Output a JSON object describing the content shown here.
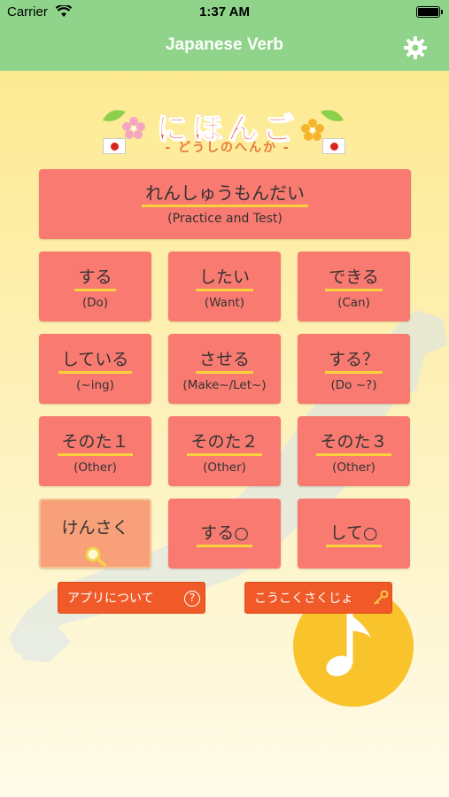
{
  "status": {
    "carrier": "Carrier",
    "time": "1:37 AM"
  },
  "nav": {
    "title": "Japanese Verb",
    "settings_icon": "gear-icon"
  },
  "logo": {
    "title": "にほんご",
    "subtitle": "- どうしのへんか -"
  },
  "practice": {
    "jp": "れんしゅうもんだい",
    "en": "(Practice and Test)"
  },
  "grid": [
    {
      "jp": "する",
      "en": "(Do)"
    },
    {
      "jp": "したい",
      "en": "(Want)"
    },
    {
      "jp": "できる",
      "en": "(Can)"
    },
    {
      "jp": "している",
      "en": "(~ing)"
    },
    {
      "jp": "させる",
      "en": "(Make~/Let~)"
    },
    {
      "jp": "する？",
      "en": "(Do ~?)"
    },
    {
      "jp": "そのた１",
      "en": "(Other)"
    },
    {
      "jp": "そのた２",
      "en": "(Other)"
    },
    {
      "jp": "そのた３",
      "en": "(Other)"
    }
  ],
  "search": {
    "label": "けんさく",
    "icon": "magnifier-icon"
  },
  "extra": [
    {
      "jp": "する○"
    },
    {
      "jp": "して○"
    }
  ],
  "footer": {
    "about": "アプリについて",
    "remove_ads": "こうこくさくじょ"
  },
  "colors": {
    "nav_green": "#8fd48a",
    "button_coral": "#f97a70",
    "underline_yellow": "#f9d23c",
    "pill_orange": "#f05a28",
    "music_yellow": "#f9c32c"
  }
}
